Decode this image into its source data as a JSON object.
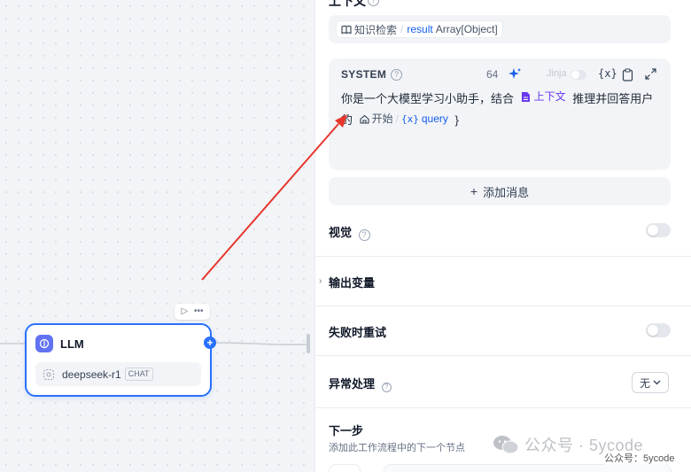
{
  "canvas": {
    "node": {
      "title": "LLM",
      "model_name": "deepseek-r1",
      "model_badge": "CHAT"
    },
    "toolbar": {
      "run_icon": "▷",
      "more_icon": "•••"
    }
  },
  "panel": {
    "context": {
      "title": "上下文",
      "source_node": "知识检索",
      "variable": "result",
      "type": "Array[Object]"
    },
    "system": {
      "label": "SYSTEM",
      "token_count": "64",
      "jinja_label": "Jinja",
      "var_button": "{x}",
      "text_before": "你是一个大模型学习小助手，结合",
      "context_var": "上下文",
      "text_middle": "推理并回答用户的",
      "query_node": "开始",
      "query_var": "query",
      "closing_brace": "}"
    },
    "add_message": "添加消息",
    "vision": {
      "label": "视觉"
    },
    "output_vars": {
      "label": "输出变量"
    },
    "retry": {
      "label": "失败时重试"
    },
    "error_handling": {
      "label": "异常处理",
      "value": "无"
    },
    "next_step": {
      "label": "下一步",
      "description": "添加此工作流程中的下一个节点"
    }
  },
  "watermark": {
    "text": "公众号 · 5ycode",
    "overlay": "公众号：5ycode"
  },
  "colors": {
    "accent": "#2970ff",
    "annotation_arrow": "#e8362d",
    "variable_purple": "#6938ef"
  }
}
